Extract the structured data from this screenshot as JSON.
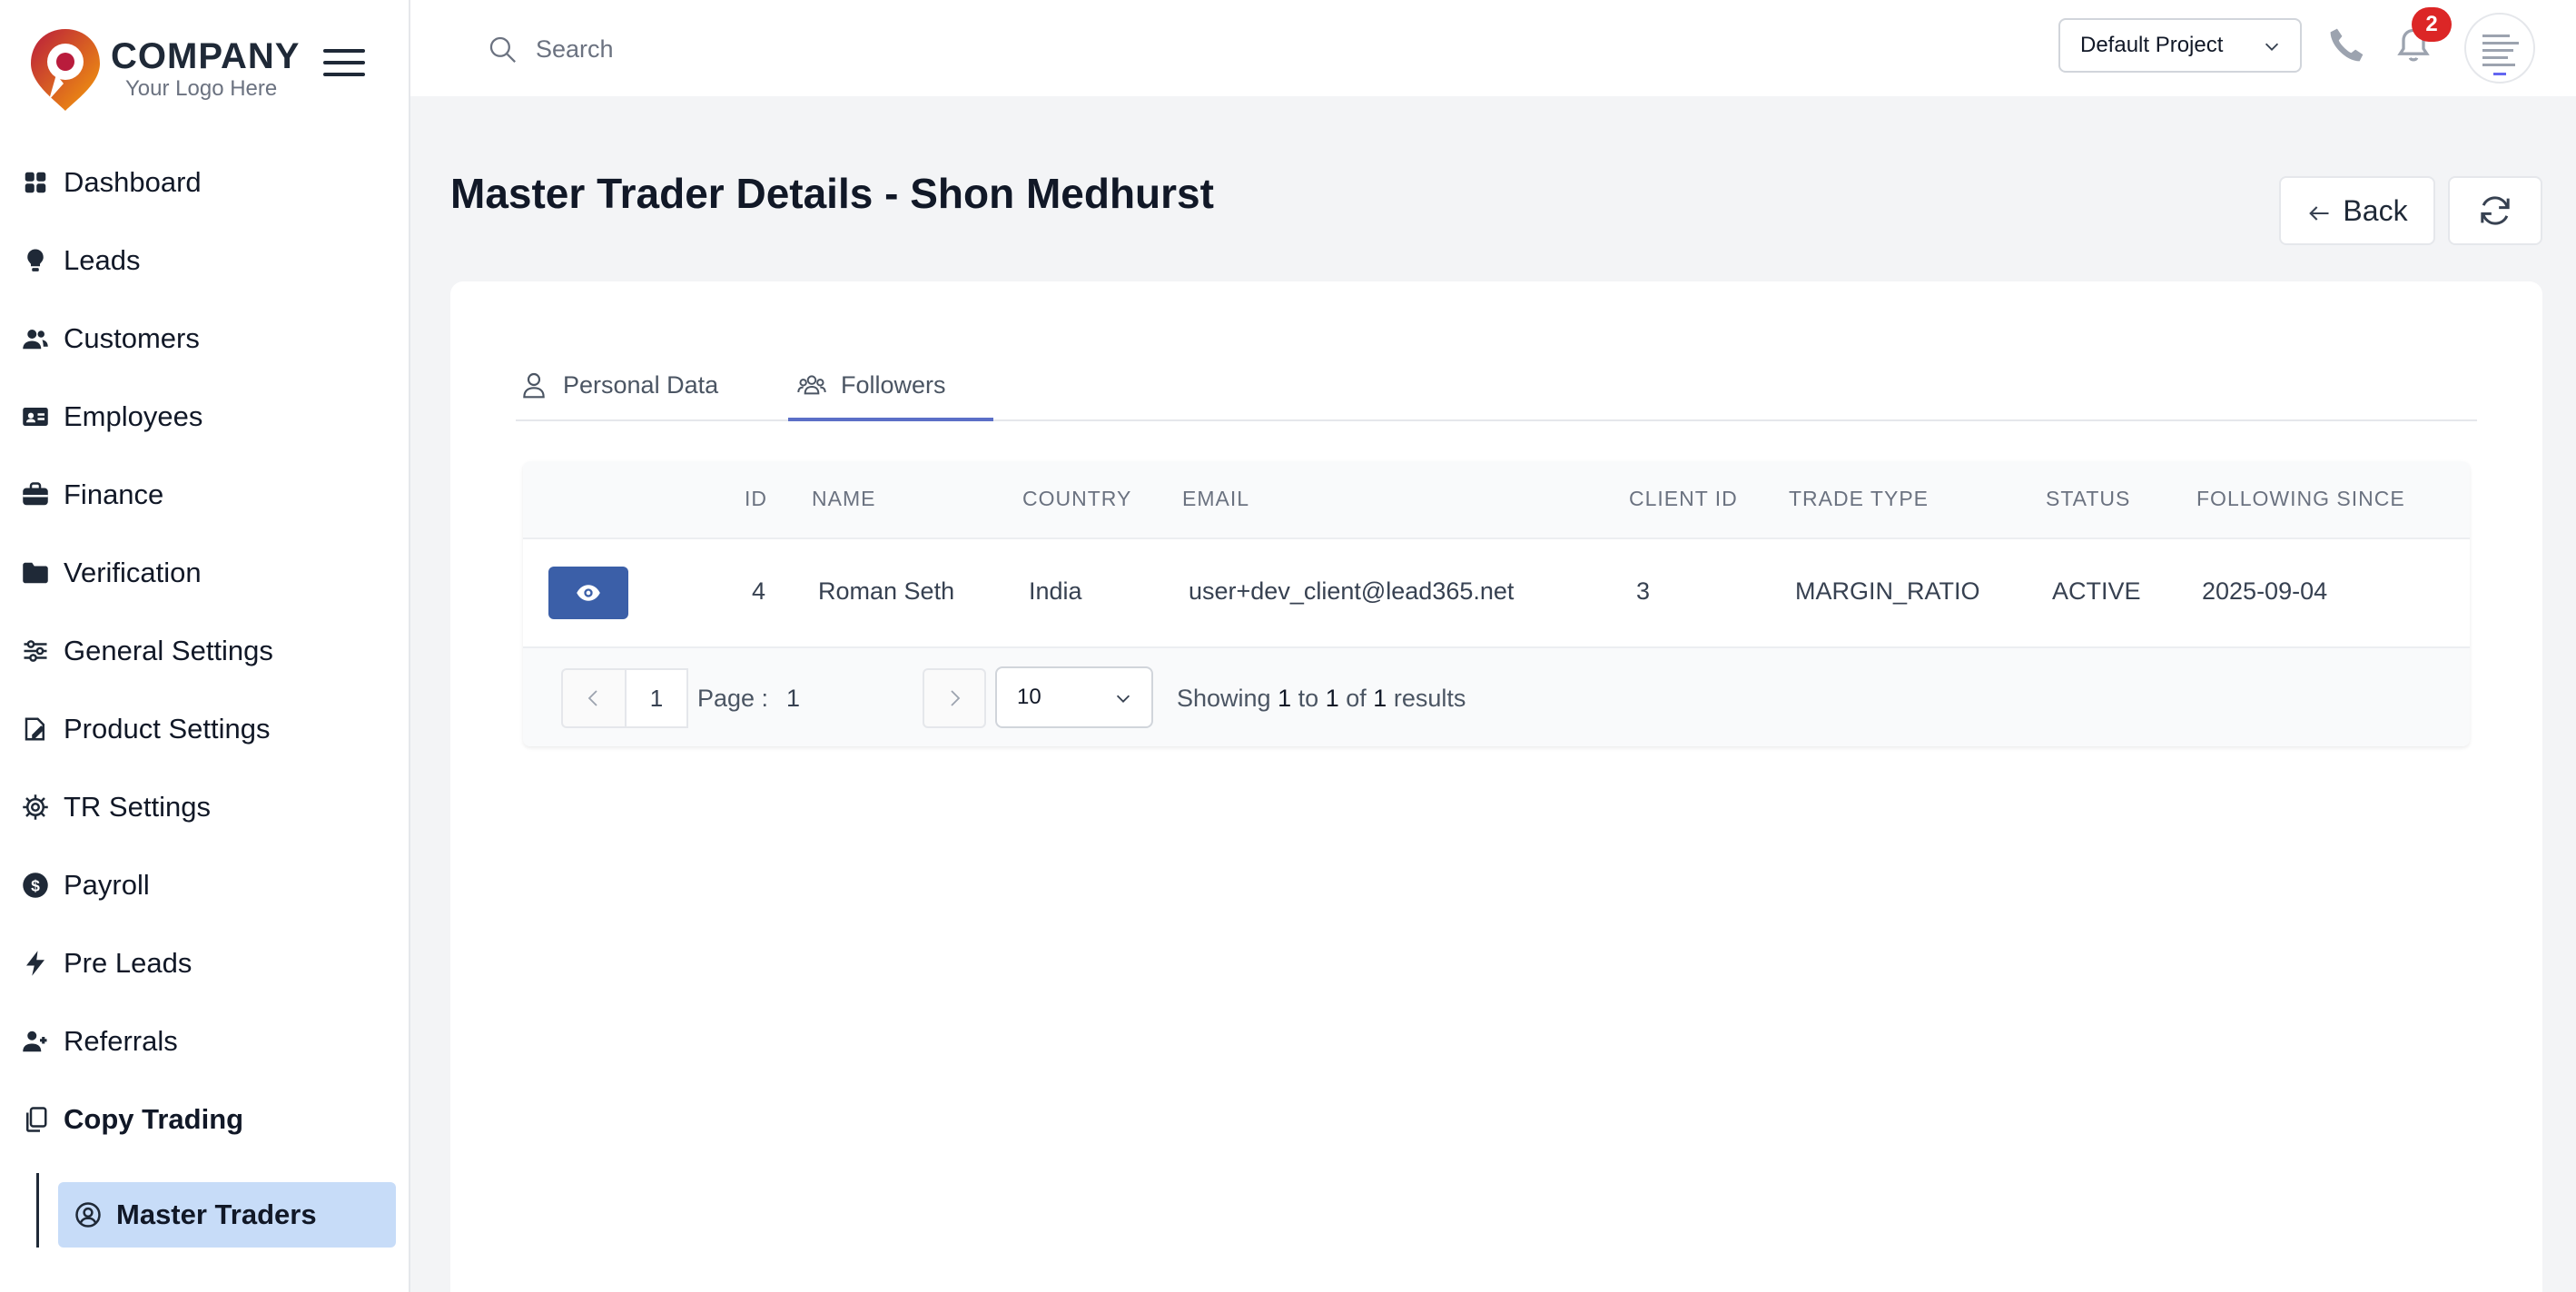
{
  "brand": {
    "name": "COMPANY",
    "tagline": "Your Logo Here"
  },
  "sidebar": {
    "items": [
      {
        "label": "Dashboard",
        "icon": "dashboard-grid-icon"
      },
      {
        "label": "Leads",
        "icon": "lightbulb-icon"
      },
      {
        "label": "Customers",
        "icon": "users-icon"
      },
      {
        "label": "Employees",
        "icon": "id-card-icon"
      },
      {
        "label": "Finance",
        "icon": "briefcase-icon"
      },
      {
        "label": "Verification",
        "icon": "folder-icon"
      },
      {
        "label": "General Settings",
        "icon": "sliders-icon"
      },
      {
        "label": "Product Settings",
        "icon": "product-edit-icon"
      },
      {
        "label": "TR Settings",
        "icon": "gear-icon"
      },
      {
        "label": "Payroll",
        "icon": "dollar-circle-icon"
      },
      {
        "label": "Pre Leads",
        "icon": "bolt-icon"
      },
      {
        "label": "Referrals",
        "icon": "user-plus-icon"
      },
      {
        "label": "Copy Trading",
        "icon": "copy-icon"
      }
    ],
    "sub_item": {
      "label": "Master Traders",
      "icon": "user-circle-icon"
    }
  },
  "topbar": {
    "search_placeholder": "Search",
    "project": "Default Project",
    "notification_count": "2"
  },
  "page": {
    "title": "Master Trader Details - Shon Medhurst",
    "back_label": "Back"
  },
  "tabs": [
    {
      "label": "Personal Data",
      "icon": "user-outline-icon"
    },
    {
      "label": "Followers",
      "icon": "group-icon",
      "active": true
    }
  ],
  "table": {
    "headers": [
      "ID",
      "NAME",
      "COUNTRY",
      "EMAIL",
      "CLIENT ID",
      "TRADE TYPE",
      "STATUS",
      "FOLLOWING SINCE"
    ],
    "rows": [
      {
        "id": "4",
        "name": "Roman Seth",
        "country": "India",
        "email": "user+dev_client@lead365.net",
        "client_id": "3",
        "trade_type": "MARGIN_RATIO",
        "status": "ACTIVE",
        "following_since": "2025-09-04"
      }
    ]
  },
  "pagination": {
    "current_page": "1",
    "page_label": "Page :",
    "page_input": "1",
    "page_size": "10",
    "showing": "Showing",
    "from": "1",
    "to_word": "to",
    "to": "1",
    "of_word": "of",
    "total": "1",
    "results_word": "results"
  },
  "colors": {
    "accent": "#3b5fa8",
    "active_nav_bg": "#c7dcf8",
    "tab_underline": "#5b6fc7",
    "badge": "#dc2626",
    "logo_red": "#b91c3c",
    "logo_orange": "#f59e0b"
  }
}
